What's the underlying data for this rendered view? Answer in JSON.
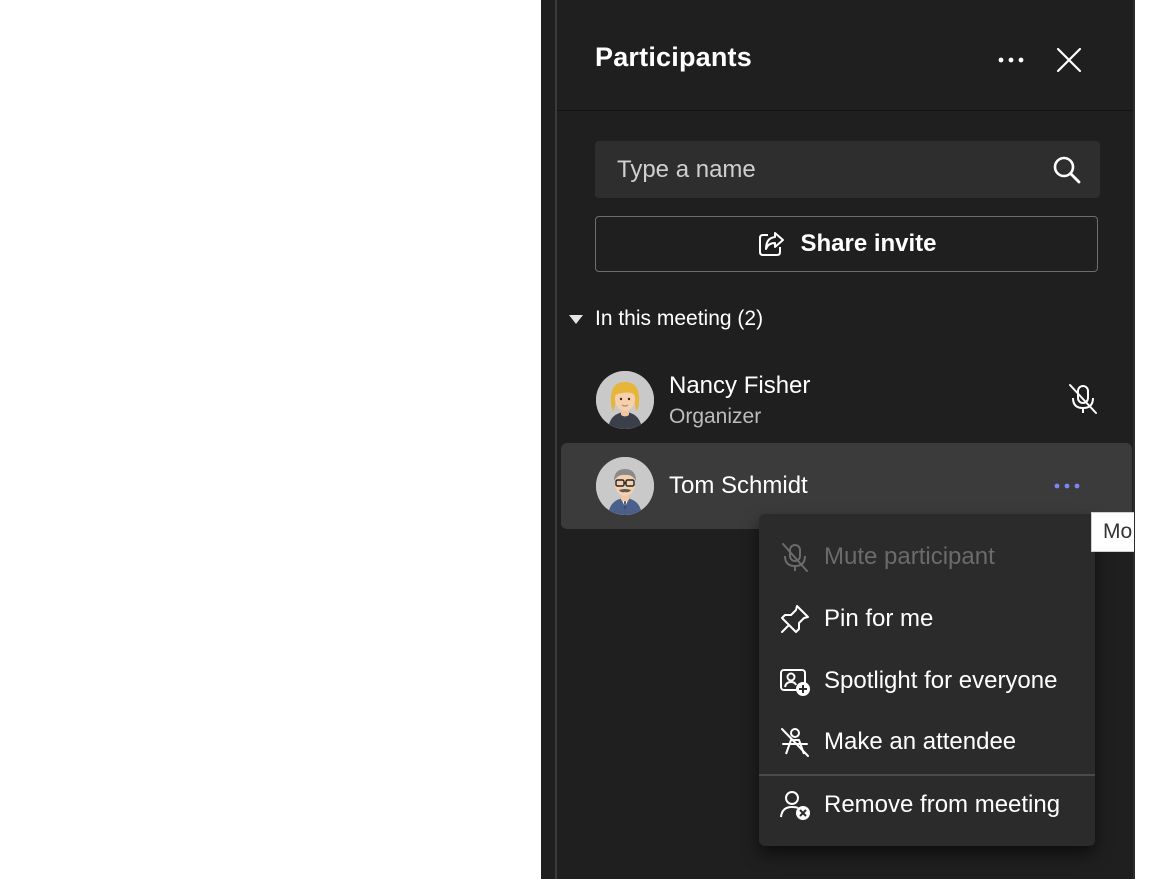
{
  "panel": {
    "title": "Participants",
    "more_icon": "more-horizontal-icon",
    "close_icon": "close-icon"
  },
  "search": {
    "placeholder": "Type a name",
    "value": "",
    "icon": "search-icon"
  },
  "share_invite": {
    "label": "Share invite",
    "icon": "share-icon"
  },
  "section": {
    "label": "In this meeting (2)",
    "expanded": true
  },
  "participants": [
    {
      "name": "Nancy Fisher",
      "role": "Organizer",
      "mic_icon": "mic-off-icon",
      "avatar_icon": "woman-avatar-icon"
    },
    {
      "name": "Tom Schmidt",
      "role": "",
      "more_icon": "more-horizontal-icon",
      "avatar_icon": "man-avatar-icon",
      "hovered": true
    }
  ],
  "context_menu": {
    "items": [
      {
        "label": "Mute participant",
        "icon": "mic-off-icon",
        "disabled": true
      },
      {
        "label": "Pin for me",
        "icon": "pin-icon",
        "disabled": false
      },
      {
        "label": "Spotlight for everyone",
        "icon": "spotlight-icon",
        "disabled": false
      },
      {
        "label": "Make an attendee",
        "icon": "make-attendee-icon",
        "disabled": false
      },
      {
        "label": "Remove from meeting",
        "icon": "remove-person-icon",
        "disabled": false
      }
    ]
  },
  "tooltip": {
    "text": "Mo"
  },
  "colors": {
    "panel_bg": "#1f1f1f",
    "hover_bg": "#3b3b3b",
    "menu_bg": "#2b2b2b",
    "accent": "#7f85f5",
    "disabled_text": "#6b6b6b"
  }
}
